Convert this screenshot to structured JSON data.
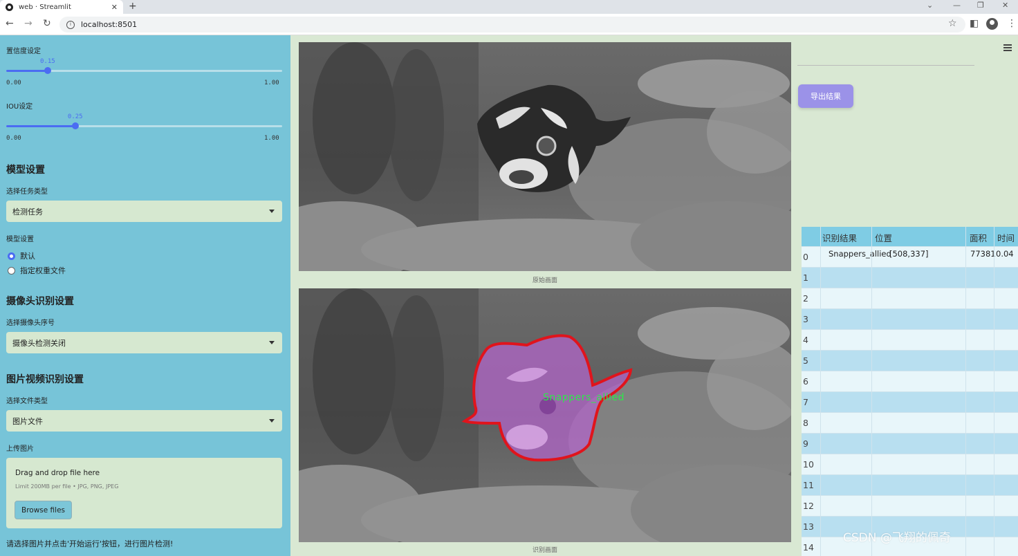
{
  "browser": {
    "tab_title": "web · Streamlit",
    "url": "localhost:8501"
  },
  "sidebar": {
    "conf_label": "置信度设定",
    "conf_value": "0.15",
    "conf_min": "0.00",
    "conf_max": "1.00",
    "conf_fraction": 0.15,
    "iou_label": "IOU设定",
    "iou_value": "0.25",
    "iou_min": "0.00",
    "iou_max": "1.00",
    "iou_fraction": 0.25,
    "model_heading": "模型设置",
    "task_label": "选择任务类型",
    "task_value": "检测任务",
    "model_label": "模型设置",
    "radio_default": "默认",
    "radio_custom": "指定权重文件",
    "camera_heading": "摄像头识别设置",
    "camera_label": "选择摄像头序号",
    "camera_value": "摄像头检测关闭",
    "media_heading": "图片视频识别设置",
    "filetype_label": "选择文件类型",
    "filetype_value": "图片文件",
    "upload_label": "上传图片",
    "upload_title": "Drag and drop file here",
    "upload_limit": "Limit 200MB per file • JPG, PNG, JPEG",
    "browse_label": "Browse files",
    "hint": "请选择图片并点击'开始运行'按钮，进行图片检测!"
  },
  "main": {
    "original_caption": "原始画面",
    "result_caption": "识别画面",
    "detection_label": "Snappers_allied",
    "accent_color": "#4b6cf2",
    "mask_color": "#b266c8",
    "outline_color": "#e0141c",
    "label_color": "#2ee84a"
  },
  "right": {
    "export_label": "导出结果",
    "table": {
      "headers": [
        "识别结果",
        "位置",
        "面积",
        "时间"
      ],
      "rows": [
        {
          "index": "0",
          "result": "Snappers_allied",
          "position": "[508,337]",
          "area": "77381",
          "time": "0.04"
        },
        {
          "index": "1"
        },
        {
          "index": "2"
        },
        {
          "index": "3"
        },
        {
          "index": "4"
        },
        {
          "index": "5"
        },
        {
          "index": "6"
        },
        {
          "index": "7"
        },
        {
          "index": "8"
        },
        {
          "index": "9"
        },
        {
          "index": "10"
        },
        {
          "index": "11"
        },
        {
          "index": "12"
        },
        {
          "index": "13"
        },
        {
          "index": "14"
        }
      ]
    },
    "watermark": "CSDN @飞翔的佩奇"
  }
}
